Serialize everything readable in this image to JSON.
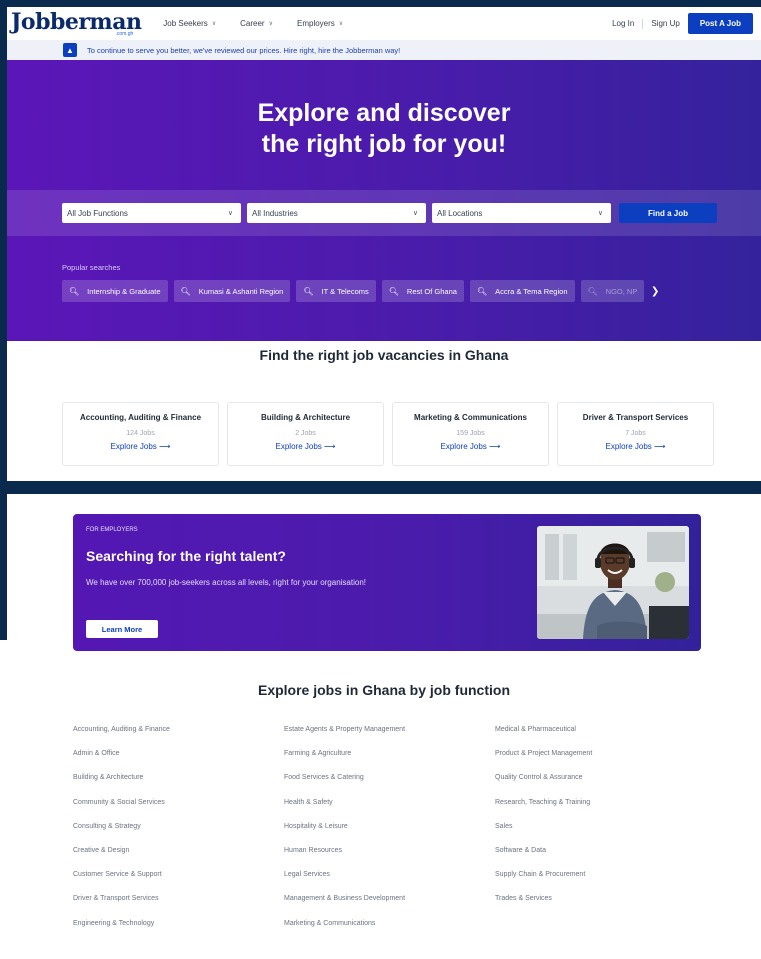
{
  "nav": {
    "logo": "Jobberman",
    "logo_sub": ".com.gh",
    "menu": [
      "Job Seekers",
      "Career",
      "Employers"
    ],
    "login": "Log In",
    "signup": "Sign Up",
    "post_job": "Post A Job"
  },
  "notice": "To continue to serve you better, we've reviewed our prices. Hire right, hire the Jobberman way!",
  "hero": {
    "title_line1": "Explore and discover",
    "title_line2": "the right job for you!",
    "filters": [
      "All Job Functions",
      "All Industries",
      "All Locations"
    ],
    "find_button": "Find a Job",
    "popular_label": "Popular searches",
    "chips": [
      "Internship & Graduate",
      "Kumasi & Ashanti Region",
      "IT & Telecoms",
      "Rest Of Ghana",
      "Accra & Tema Region",
      "NGO, NP"
    ]
  },
  "vacancies": {
    "title": "Find the right job vacancies in Ghana",
    "cards": [
      {
        "title": "Accounting, Auditing & Finance",
        "count": "124 Jobs",
        "link": "Explore Jobs"
      },
      {
        "title": "Building & Architecture",
        "count": "2 Jobs",
        "link": "Explore Jobs"
      },
      {
        "title": "Marketing & Communications",
        "count": "159 Jobs",
        "link": "Explore Jobs"
      },
      {
        "title": "Driver & Transport Services",
        "count": "7 Jobs",
        "link": "Explore Jobs"
      }
    ]
  },
  "employers": {
    "kicker": "FOR EMPLOYERS",
    "title": "Searching for the right talent?",
    "text": "We have over 700,000 job-seekers across all levels, right for your organisation!",
    "button": "Learn More"
  },
  "functions": {
    "title": "Explore jobs in Ghana by job function",
    "col1": [
      "Accounting, Auditing & Finance",
      "Admin & Office",
      "Building & Architecture",
      "Community & Social Services",
      "Consulting & Strategy",
      "Creative & Design",
      "Customer Service & Support",
      "Driver & Transport Services",
      "Engineering & Technology"
    ],
    "col2": [
      "Estate Agents & Property Management",
      "Farming & Agriculture",
      "Food Services & Catering",
      "Health & Safety",
      "Hospitality & Leisure",
      "Human Resources",
      "Legal Services",
      "Management & Business Development",
      "Marketing & Communications"
    ],
    "col3": [
      "Medical & Pharmaceutical",
      "Product & Project Management",
      "Quality Control & Assurance",
      "Research, Teaching & Training",
      "Sales",
      "Software & Data",
      "Supply Chain & Procurement",
      "Trades & Services"
    ]
  },
  "colors": {
    "brand_blue": "#0b3fbf",
    "hero_purple": "#5b16b8",
    "frame": "#0a2a4d"
  }
}
